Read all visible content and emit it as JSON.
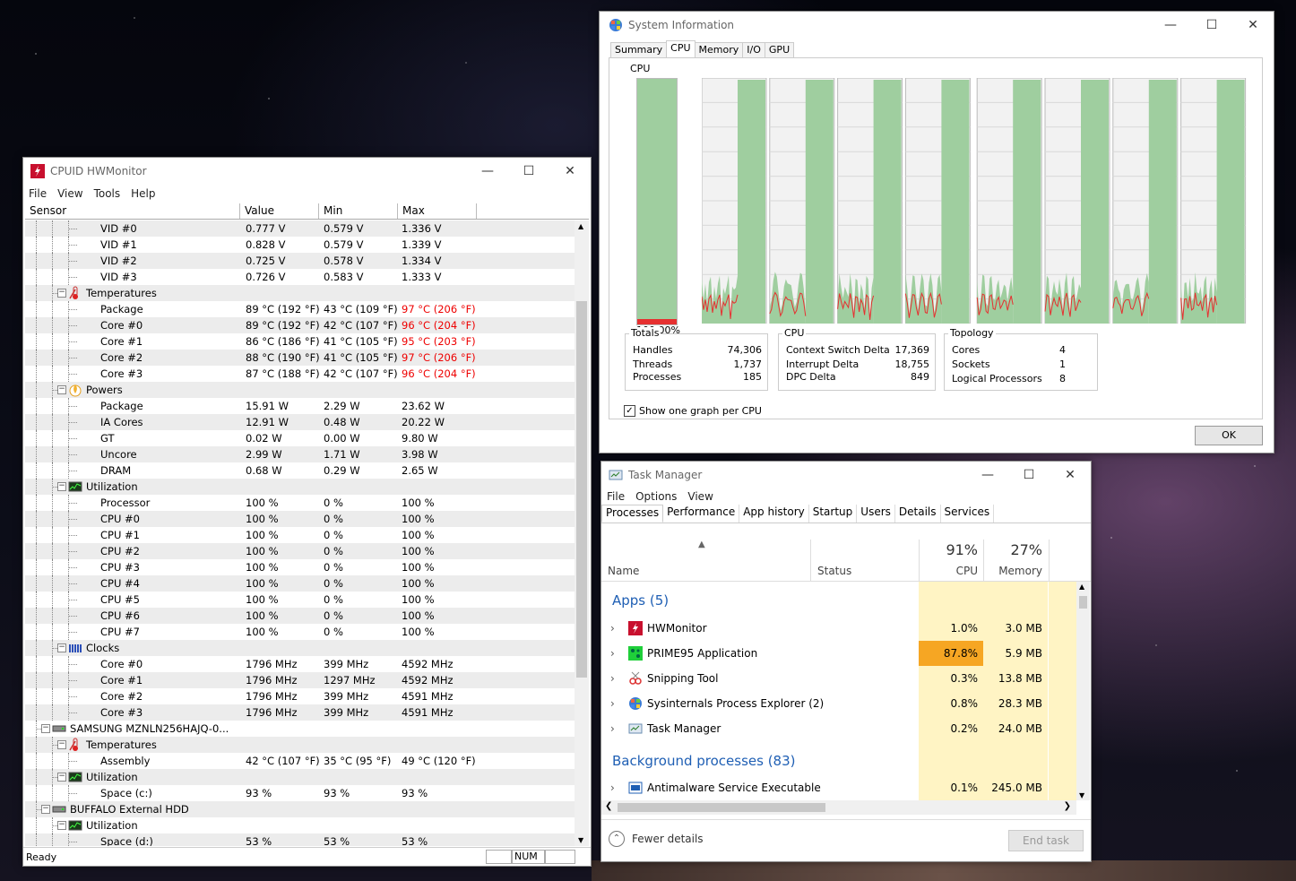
{
  "hwmonitor": {
    "title": "CPUID HWMonitor",
    "menu": [
      "File",
      "View",
      "Tools",
      "Help"
    ],
    "columns": [
      "Sensor",
      "Value",
      "Min",
      "Max"
    ],
    "status": {
      "text": "Ready",
      "num": "NUM"
    },
    "rows": [
      {
        "depth": 3,
        "label": "VID #0",
        "value": "0.777 V",
        "min": "0.579 V",
        "max": "1.336 V"
      },
      {
        "depth": 3,
        "label": "VID #1",
        "value": "0.828 V",
        "min": "0.579 V",
        "max": "1.339 V"
      },
      {
        "depth": 3,
        "label": "VID #2",
        "value": "0.725 V",
        "min": "0.578 V",
        "max": "1.334 V"
      },
      {
        "depth": 3,
        "label": "VID #3",
        "value": "0.726 V",
        "min": "0.583 V",
        "max": "1.333 V"
      },
      {
        "depth": 2,
        "group": true,
        "icon": "thermometer-icon",
        "label": "Temperatures"
      },
      {
        "depth": 3,
        "label": "Package",
        "value": "89 °C  (192 °F)",
        "min": "43 °C  (109 °F)",
        "max": "97 °C  (206 °F)",
        "hot": true
      },
      {
        "depth": 3,
        "label": "Core #0",
        "value": "89 °C  (192 °F)",
        "min": "42 °C  (107 °F)",
        "max": "96 °C  (204 °F)",
        "hot": true
      },
      {
        "depth": 3,
        "label": "Core #1",
        "value": "86 °C  (186 °F)",
        "min": "41 °C  (105 °F)",
        "max": "95 °C  (203 °F)",
        "hot": true
      },
      {
        "depth": 3,
        "label": "Core #2",
        "value": "88 °C  (190 °F)",
        "min": "41 °C  (105 °F)",
        "max": "97 °C  (206 °F)",
        "hot": true
      },
      {
        "depth": 3,
        "label": "Core #3",
        "value": "87 °C  (188 °F)",
        "min": "42 °C  (107 °F)",
        "max": "96 °C  (204 °F)",
        "hot": true
      },
      {
        "depth": 2,
        "group": true,
        "icon": "power-icon",
        "label": "Powers"
      },
      {
        "depth": 3,
        "label": "Package",
        "value": "15.91 W",
        "min": "2.29 W",
        "max": "23.62 W"
      },
      {
        "depth": 3,
        "label": "IA Cores",
        "value": "12.91 W",
        "min": "0.48 W",
        "max": "20.22 W"
      },
      {
        "depth": 3,
        "label": "GT",
        "value": "0.02 W",
        "min": "0.00 W",
        "max": "9.80 W"
      },
      {
        "depth": 3,
        "label": "Uncore",
        "value": "2.99 W",
        "min": "1.71 W",
        "max": "3.98 W"
      },
      {
        "depth": 3,
        "label": "DRAM",
        "value": "0.68 W",
        "min": "0.29 W",
        "max": "2.65 W"
      },
      {
        "depth": 2,
        "group": true,
        "icon": "utilization-icon",
        "label": "Utilization"
      },
      {
        "depth": 3,
        "label": "Processor",
        "value": "100 %",
        "min": "0 %",
        "max": "100 %"
      },
      {
        "depth": 3,
        "label": "CPU #0",
        "value": "100 %",
        "min": "0 %",
        "max": "100 %"
      },
      {
        "depth": 3,
        "label": "CPU #1",
        "value": "100 %",
        "min": "0 %",
        "max": "100 %"
      },
      {
        "depth": 3,
        "label": "CPU #2",
        "value": "100 %",
        "min": "0 %",
        "max": "100 %"
      },
      {
        "depth": 3,
        "label": "CPU #3",
        "value": "100 %",
        "min": "0 %",
        "max": "100 %"
      },
      {
        "depth": 3,
        "label": "CPU #4",
        "value": "100 %",
        "min": "0 %",
        "max": "100 %"
      },
      {
        "depth": 3,
        "label": "CPU #5",
        "value": "100 %",
        "min": "0 %",
        "max": "100 %"
      },
      {
        "depth": 3,
        "label": "CPU #6",
        "value": "100 %",
        "min": "0 %",
        "max": "100 %"
      },
      {
        "depth": 3,
        "label": "CPU #7",
        "value": "100 %",
        "min": "0 %",
        "max": "100 %"
      },
      {
        "depth": 2,
        "group": true,
        "icon": "clock-icon",
        "label": "Clocks"
      },
      {
        "depth": 3,
        "label": "Core #0",
        "value": "1796 MHz",
        "min": "399 MHz",
        "max": "4592 MHz"
      },
      {
        "depth": 3,
        "label": "Core #1",
        "value": "1796 MHz",
        "min": "1297 MHz",
        "max": "4592 MHz"
      },
      {
        "depth": 3,
        "label": "Core #2",
        "value": "1796 MHz",
        "min": "399 MHz",
        "max": "4591 MHz"
      },
      {
        "depth": 3,
        "label": "Core #3",
        "value": "1796 MHz",
        "min": "399 MHz",
        "max": "4591 MHz"
      },
      {
        "depth": 1,
        "group": true,
        "icon": "drive-icon",
        "label": "SAMSUNG MZNLN256HAJQ-0..."
      },
      {
        "depth": 2,
        "group": true,
        "icon": "thermometer-icon",
        "label": "Temperatures"
      },
      {
        "depth": 3,
        "label": "Assembly",
        "value": "42 °C  (107 °F)",
        "min": "35 °C  (95 °F)",
        "max": "49 °C  (120 °F)"
      },
      {
        "depth": 2,
        "group": true,
        "icon": "utilization-icon",
        "label": "Utilization"
      },
      {
        "depth": 3,
        "label": "Space (c:)",
        "value": "93 %",
        "min": "93 %",
        "max": "93 %"
      },
      {
        "depth": 1,
        "group": true,
        "icon": "drive-icon",
        "label": "BUFFALO External HDD"
      },
      {
        "depth": 2,
        "group": true,
        "icon": "utilization-icon",
        "label": "Utilization"
      },
      {
        "depth": 3,
        "label": "Space (d:)",
        "value": "53 %",
        "min": "53 %",
        "max": "53 %"
      }
    ]
  },
  "sysinfo": {
    "title": "System Information",
    "tabs": [
      "Summary",
      "CPU",
      "Memory",
      "I/O",
      "GPU"
    ],
    "active_tab": "CPU",
    "cpu_label": "CPU",
    "total_percent": "100.00%",
    "totals": {
      "label": "Totals",
      "items": [
        {
          "k": "Handles",
          "v": "74,306"
        },
        {
          "k": "Threads",
          "v": "1,737"
        },
        {
          "k": "Processes",
          "v": "185"
        }
      ]
    },
    "cpu": {
      "label": "CPU",
      "items": [
        {
          "k": "Context Switch Delta",
          "v": "17,369"
        },
        {
          "k": "Interrupt Delta",
          "v": "18,755"
        },
        {
          "k": "DPC Delta",
          "v": "849"
        }
      ]
    },
    "topology": {
      "label": "Topology",
      "items": [
        {
          "k": "Cores",
          "v": "4"
        },
        {
          "k": "Sockets",
          "v": "1"
        },
        {
          "k": "Logical Processors",
          "v": "8"
        }
      ]
    },
    "checkbox_label": "Show one graph per CPU",
    "ok_label": "OK",
    "colors": {
      "graph_fill": "#9fce9f",
      "kernel": "#e63030",
      "grid": "#d8d8d8"
    },
    "per_cpu_graphs": 8
  },
  "taskmanager": {
    "title": "Task Manager",
    "menu": [
      "File",
      "Options",
      "View"
    ],
    "tabs": [
      "Processes",
      "Performance",
      "App history",
      "Startup",
      "Users",
      "Details",
      "Services"
    ],
    "active_tab": "Processes",
    "columns": {
      "name": "Name",
      "status": "Status",
      "cpu_pct": "91%",
      "cpu": "CPU",
      "mem_pct": "27%",
      "mem": "Memory"
    },
    "apps_group": "Apps (5)",
    "bg_group": "Background processes (83)",
    "apps": [
      {
        "icon": "hwmonitor-icon",
        "name": "HWMonitor",
        "cpu": "1.0%",
        "mem": "3.0 MB"
      },
      {
        "icon": "prime95-icon",
        "name": "PRIME95 Application",
        "cpu": "87.8%",
        "mem": "5.9 MB",
        "hot": true
      },
      {
        "icon": "snipping-tool-icon",
        "name": "Snipping Tool",
        "cpu": "0.3%",
        "mem": "13.8 MB"
      },
      {
        "icon": "process-explorer-icon",
        "name": "Sysinternals Process Explorer (2)",
        "cpu": "0.8%",
        "mem": "28.3 MB"
      },
      {
        "icon": "task-manager-icon",
        "name": "Task Manager",
        "cpu": "0.2%",
        "mem": "24.0 MB"
      }
    ],
    "bg": [
      {
        "icon": "antimalware-icon",
        "name": "Antimalware Service Executable",
        "cpu": "0.1%",
        "mem": "245.0 MB"
      }
    ],
    "fewer_details": "Fewer details",
    "end_task": "End task"
  }
}
